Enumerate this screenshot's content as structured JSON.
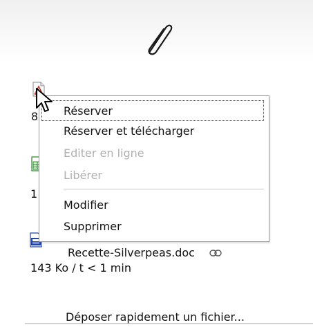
{
  "attachments_icon": "paperclip-icon",
  "files": [
    {
      "type_icon": "pdf-file-icon",
      "visible_meta_fragment": "8"
    },
    {
      "type_icon": "xls-file-icon",
      "visible_meta_fragment": "1"
    },
    {
      "type_icon": "doc-file-icon",
      "name": "Recette-Silverpeas.doc",
      "link_icon": "link-icon",
      "meta": "143 Ko / t < 1 min"
    }
  ],
  "context_menu": {
    "items": [
      {
        "label": "Réserver",
        "enabled": true
      },
      {
        "label": "Réserver et télécharger",
        "enabled": true
      },
      {
        "label": "Editer en ligne",
        "enabled": false
      },
      {
        "label": "Libérer",
        "enabled": false
      },
      {
        "label": "Modifier",
        "enabled": true
      },
      {
        "label": "Supprimer",
        "enabled": true
      }
    ]
  },
  "upload_link": "Déposer rapidement un fichier...",
  "colors": {
    "text": "#111111",
    "disabled_text": "#b0b0b0",
    "menu_border": "#9a9a9a",
    "pdf_red": "#c0392b",
    "xls_green": "#2e8b2e",
    "doc_blue": "#2244aa"
  }
}
